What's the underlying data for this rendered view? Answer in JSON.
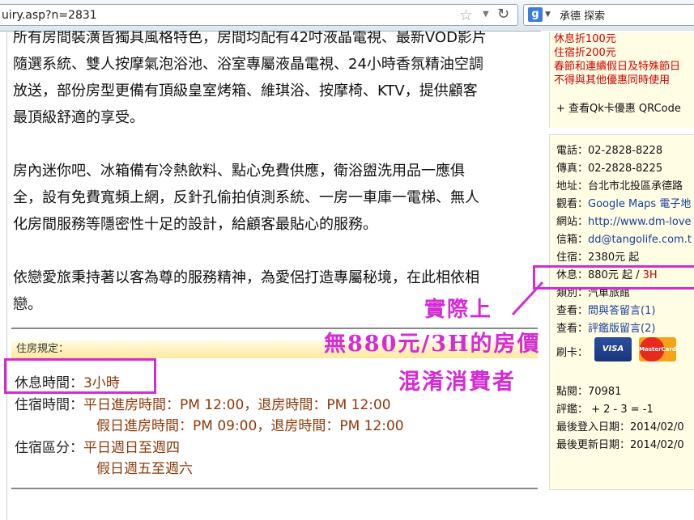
{
  "browser": {
    "url": "uiry.asp?n=2831",
    "search_text": "承德 探索",
    "search_engine_letter": "g"
  },
  "content": {
    "para1_lines": [
      "所有房間裝潢皆獨具風格特色，房間均配有42吋液晶電視、最新VOD影片",
      "隨選系統、雙人按摩氣泡浴池、浴室專屬液晶電視、24小時香氛精油空調",
      "放送，部份房型更備有頂級皇室烤箱、維琪浴、按摩椅、KTV，提供顧客",
      "最頂級舒適的享受。"
    ],
    "para2_lines": [
      "房內迷你吧、冰箱備有冷熱飲料、點心免費供應，衛浴盥洗用品一應俱",
      "全，設有免費寬頻上網，反針孔偷拍偵測系統、一房一車庫一電梯、無人",
      "化房間服務等隱密性十足的設計，給顧客最貼心的服務。"
    ],
    "para3_lines": [
      "依戀愛旅秉持著以客為尊的服務精神，為愛侶打造專屬秘境，在此相依相",
      "戀。"
    ]
  },
  "rules": {
    "header": "住房規定：",
    "rest_label": "休息時間：",
    "rest_value": "3小時",
    "stay_label": "住宿時間：",
    "stay_weekday": "平日進房時間：PM 12:00，退房時間：PM 12:00",
    "stay_holiday": "假日進房時間：PM 09:00，退房時間：PM 12:00",
    "zone_label": "住宿區分：",
    "zone_weekday": "平日週日至週四",
    "zone_holiday": "假日週五至週六"
  },
  "annotation": {
    "line1": "實際上",
    "line2": "無880元/3H的房價",
    "line3": "混淆消費者"
  },
  "sidebar": {
    "promo_lines": [
      "休息折100元",
      "住宿折200元",
      "春節和連續假日及特殊節日",
      "不得與其他優惠同時使用"
    ],
    "qk_link": "+ 查看Qk卡優惠 QRCode",
    "phone": "電話：02-2828-8228",
    "fax": "傳真：02-2828-8225",
    "address": "地址：台北市北投區承德路",
    "map_label": "觀看：",
    "map_link": "Google Maps 電子地",
    "web_label": "網站：",
    "web_link": "http://www.dm-love",
    "mail_label": "信箱：",
    "mail_link": "dd@tangolife.com.t",
    "stay_price": "住宿：2380元 起",
    "rest_price_label": "休息：880元 起 / ",
    "rest_price_unit": "3H",
    "category": "類別：汽車旅館",
    "qa_label": "查看：",
    "qa_link": "問與答留言(1)",
    "review_label": "查看：",
    "review_link": "評鑑版留言(2)",
    "card_label": "刷卡：",
    "card_visa": "VISA",
    "card_master": "MasterCard",
    "points": "點閱：70981",
    "rating": "評鑑： + 2 - 3 = -1",
    "last_login": "最後登入日期：2014/02/0",
    "last_update": "最後更新日期：2014/02/0"
  },
  "colors": {
    "highlight": "#d42bd2",
    "value_text": "#8b3a0a",
    "promo_text": "#cc0000",
    "link": "#1a3e9c"
  }
}
